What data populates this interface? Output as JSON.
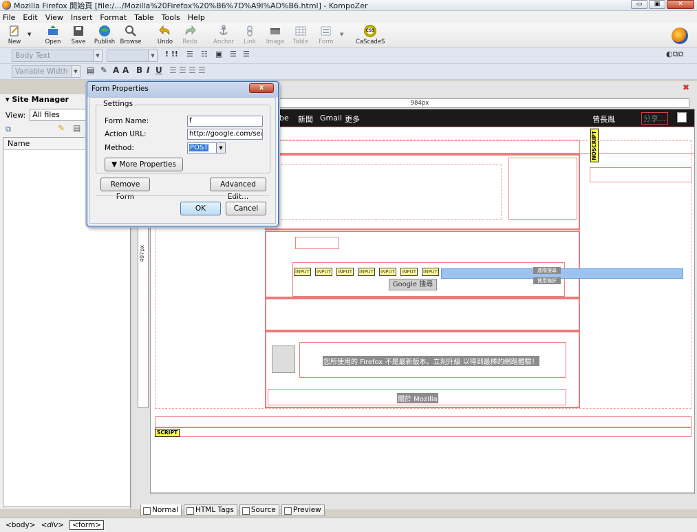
{
  "window": {
    "title": "Mozilla Firefox 開始頁 [file:/.../Mozilla%20Firefox%20%B6%7D%A9l%AD%B6.html] - KompoZer",
    "minimize": "▭",
    "maximize": "▣",
    "close": "✕"
  },
  "menu": [
    "File",
    "Edit",
    "View",
    "Insert",
    "Format",
    "Table",
    "Tools",
    "Help"
  ],
  "toolbar": {
    "buttons": [
      {
        "label": "New",
        "icon": "new-icon"
      },
      {
        "label": "Open",
        "icon": "open-icon"
      },
      {
        "label": "Save",
        "icon": "save-icon"
      },
      {
        "label": "Publish",
        "icon": "publish-icon"
      },
      {
        "label": "Browse",
        "icon": "browse-icon"
      },
      {
        "label": "Undo",
        "icon": "undo-icon"
      },
      {
        "label": "Redo",
        "icon": "redo-icon"
      },
      {
        "label": "Anchor",
        "icon": "anchor-icon"
      },
      {
        "label": "Link",
        "icon": "link-icon"
      },
      {
        "label": "Image",
        "icon": "image-icon"
      },
      {
        "label": "Table",
        "icon": "table-icon"
      },
      {
        "label": "Form",
        "icon": "form-icon"
      },
      {
        "label": "CaScadeS",
        "icon": "css-icon"
      }
    ],
    "css_badge": "CSS"
  },
  "format": {
    "paragraph_style": "Body Text",
    "width_style": "Variable Width",
    "bold": "B",
    "italic": "I",
    "underline": "U",
    "list_marks": "! !!"
  },
  "site_manager": {
    "title": "Site Manager",
    "view_label": "View:",
    "view_value": "All files",
    "column": "Name"
  },
  "editor": {
    "hruler": "984px",
    "vruler": "497px",
    "gbar_links": [
      "ube",
      "新聞",
      "Gmail",
      "更多"
    ],
    "gbar_user": "曾長胤",
    "gbar_share": "分享...",
    "noscript_tag": "NOSCRIPT",
    "input_tags": [
      "INPUT",
      "INPUT",
      "INPUT",
      "INPUT",
      "INPUT",
      "INPUT",
      "INPUT"
    ],
    "search_button": "Google 搜尋",
    "side_links": [
      "進階搜尋",
      "使用偏好"
    ],
    "notice": "您所使用的 Firefox 不是最新版本。立刻升級 以得到最棒的網路體驗！",
    "about": "關於 Mozilla",
    "script_tag": "SCRIPT"
  },
  "view_tabs": [
    "Normal",
    "HTML Tags",
    "Source",
    "Preview"
  ],
  "statusbar": [
    "<body>",
    "<div>",
    "<form>"
  ],
  "dialog": {
    "title": "Form Properties",
    "close": "x",
    "group": "Settings",
    "form_name_label": "Form Name:",
    "form_name_value": "f",
    "action_label": "Action URL:",
    "action_value": "http://google.com/sear",
    "method_label": "Method:",
    "method_value": "POST",
    "more_properties": "▼  More Properties",
    "remove": "Remove Form",
    "advanced": "Advanced Edit...",
    "ok": "OK",
    "cancel": "Cancel"
  }
}
